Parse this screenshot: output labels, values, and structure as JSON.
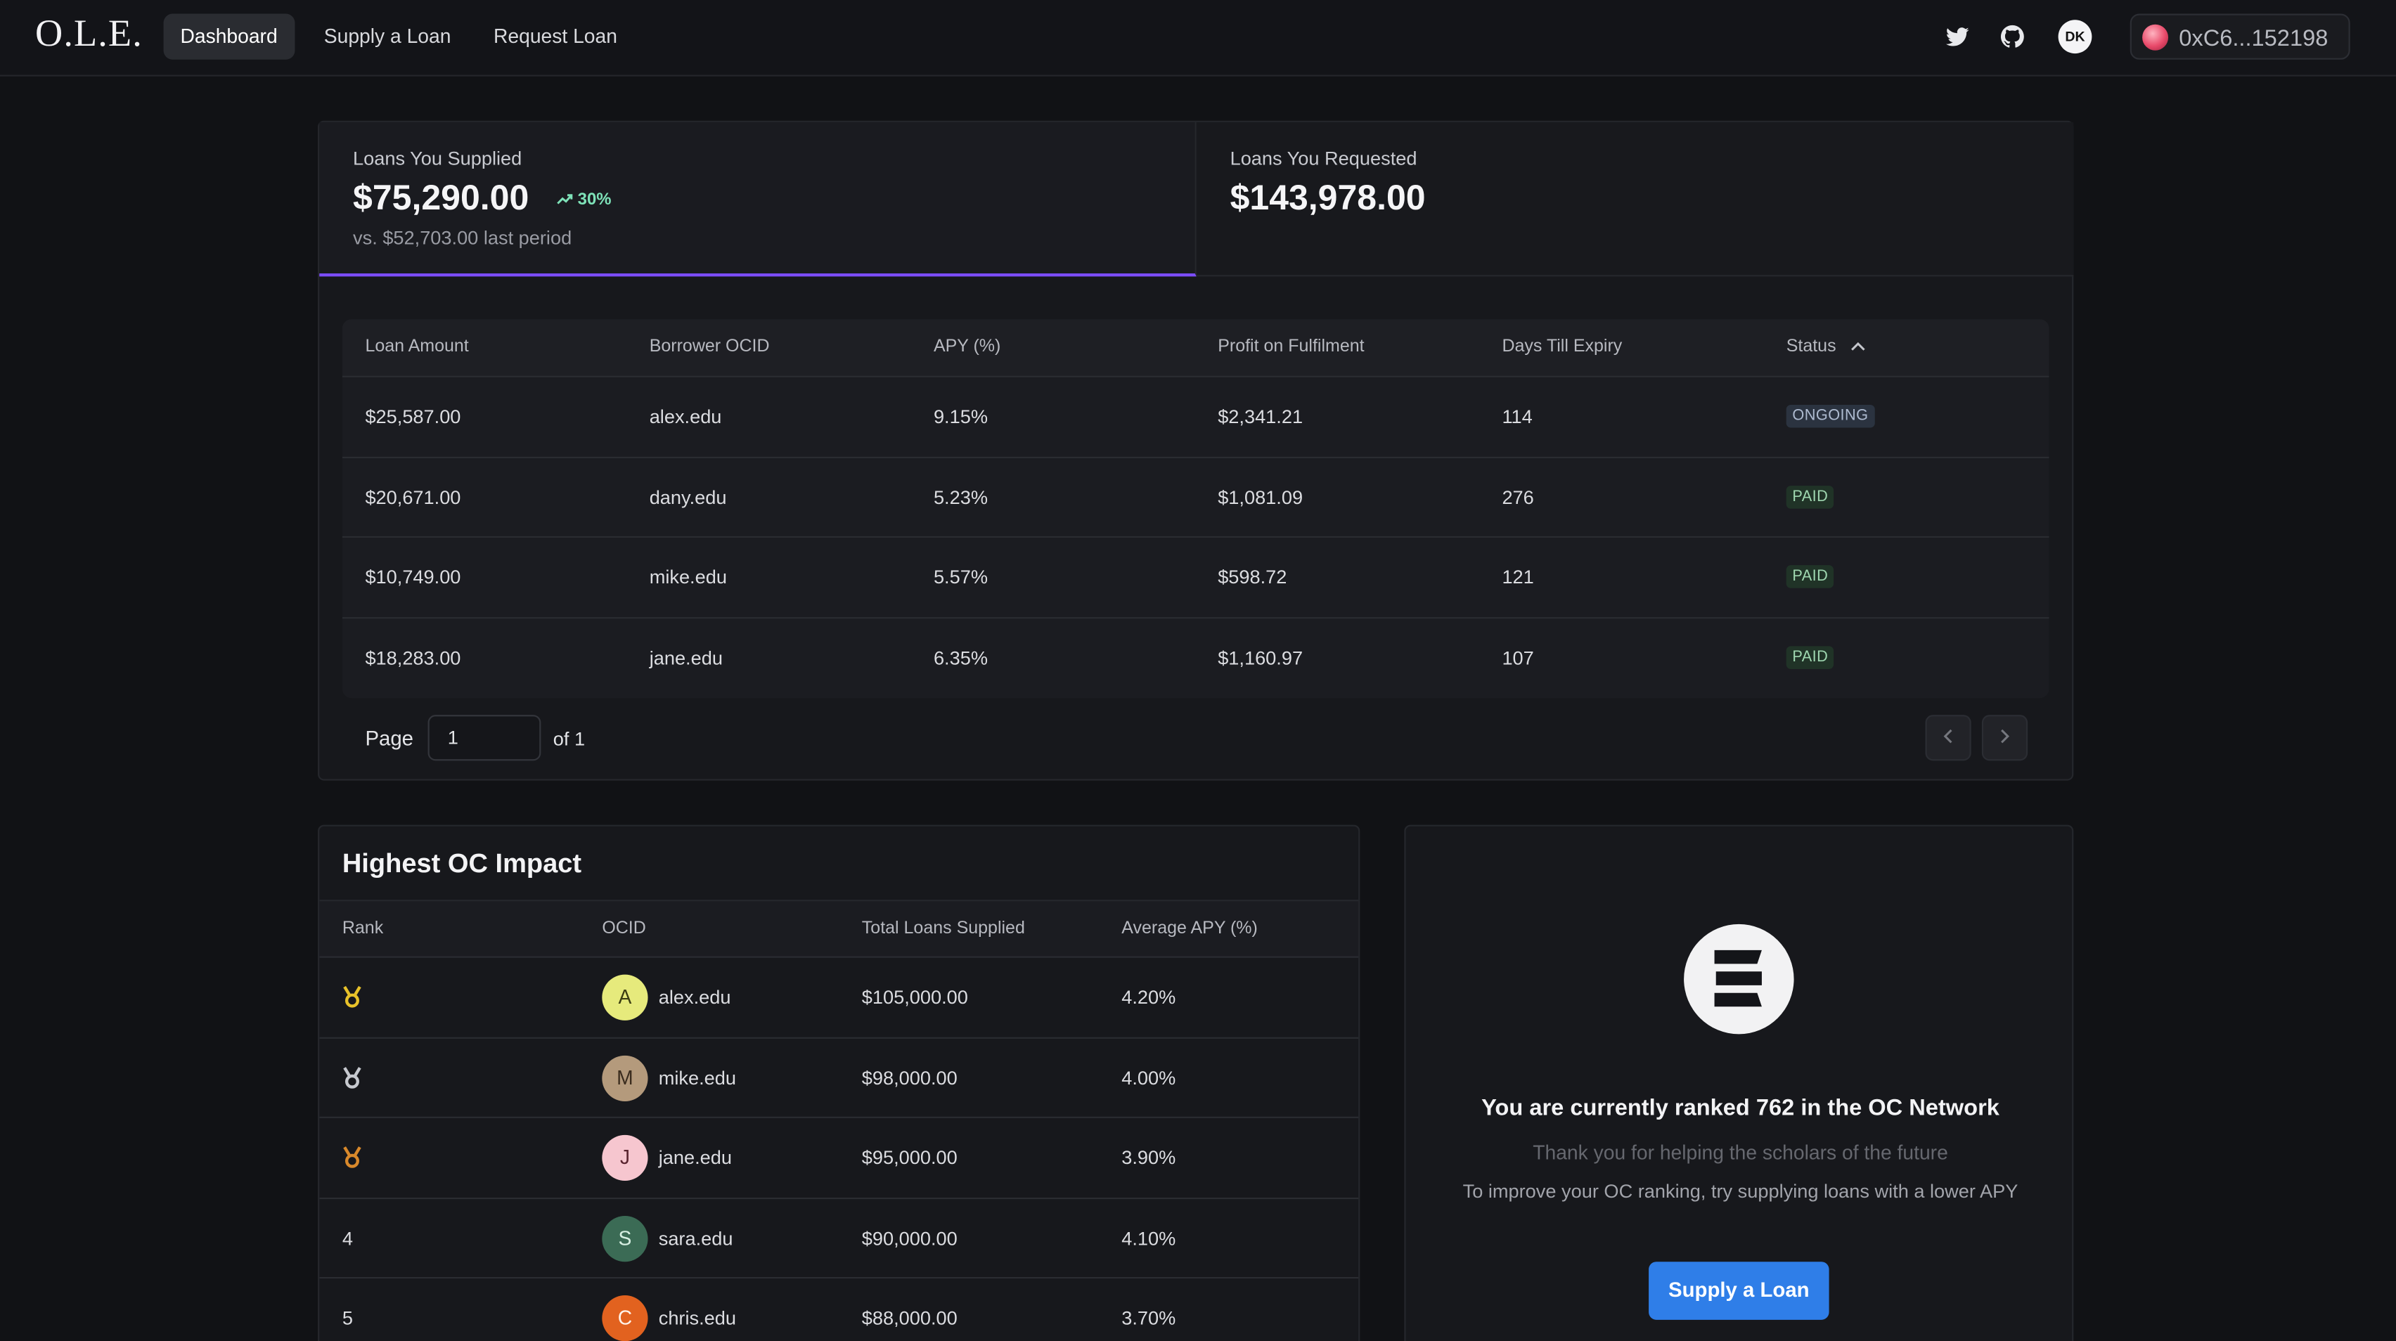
{
  "brand": {
    "logo_text": "O.L.E."
  },
  "nav": {
    "links": [
      "Dashboard",
      "Supply a Loan",
      "Request Loan"
    ],
    "active": "Dashboard",
    "user_initials": "DK",
    "wallet_address": "0xC6...152198"
  },
  "stats": {
    "supplied": {
      "label": "Loans You Supplied",
      "value": "$75,290.00",
      "delta": "30%",
      "compare": "vs. $52,703.00 last period"
    },
    "requested": {
      "label": "Loans You Requested",
      "value": "$143,978.00"
    }
  },
  "loans_table": {
    "columns": [
      "Loan Amount",
      "Borrower OCID",
      "APY (%)",
      "Profit on Fulfilment",
      "Days Till Expiry",
      "Status"
    ],
    "rows": [
      {
        "amount": "$25,587.00",
        "ocid": "alex.edu",
        "apy": "9.15%",
        "profit": "$2,341.21",
        "days": "114",
        "status": "ONGOING"
      },
      {
        "amount": "$20,671.00",
        "ocid": "dany.edu",
        "apy": "5.23%",
        "profit": "$1,081.09",
        "days": "276",
        "status": "PAID"
      },
      {
        "amount": "$10,749.00",
        "ocid": "mike.edu",
        "apy": "5.57%",
        "profit": "$598.72",
        "days": "121",
        "status": "PAID"
      },
      {
        "amount": "$18,283.00",
        "ocid": "jane.edu",
        "apy": "6.35%",
        "profit": "$1,160.97",
        "days": "107",
        "status": "PAID"
      }
    ]
  },
  "pagination": {
    "page_label": "Page",
    "current_page": "1",
    "of_label": "of 1"
  },
  "leaderboard": {
    "title": "Highest OC Impact",
    "columns": [
      "Rank",
      "OCID",
      "Total Loans Supplied",
      "Average APY (%)"
    ],
    "rows": [
      {
        "rank": "",
        "medal": "gold",
        "initial": "A",
        "avatar_color": "#e6ea7c",
        "avatar_text": "#3b3d12",
        "ocid": "alex.edu",
        "total": "$105,000.00",
        "apy": "4.20%"
      },
      {
        "rank": "",
        "medal": "silver",
        "initial": "M",
        "avatar_color": "#b49a7c",
        "avatar_text": "#3a2c1e",
        "ocid": "mike.edu",
        "total": "$98,000.00",
        "apy": "4.00%"
      },
      {
        "rank": "",
        "medal": "bronze",
        "initial": "J",
        "avatar_color": "#f6c6cf",
        "avatar_text": "#5a2530",
        "ocid": "jane.edu",
        "total": "$95,000.00",
        "apy": "3.90%"
      },
      {
        "rank": "4",
        "medal": "",
        "initial": "S",
        "avatar_color": "#3b6b55",
        "avatar_text": "#d7efe2",
        "ocid": "sara.edu",
        "total": "$90,000.00",
        "apy": "4.10%"
      },
      {
        "rank": "5",
        "medal": "",
        "initial": "C",
        "avatar_color": "#e2621f",
        "avatar_text": "#fff3ea",
        "ocid": "chris.edu",
        "total": "$88,000.00",
        "apy": "3.70%"
      }
    ]
  },
  "rank_panel": {
    "title": "You are currently ranked 762 in the OC Network",
    "thanks": "Thank you for helping the scholars of the future",
    "tip": "To improve your OC ranking, try supplying loans with a lower APY",
    "cta": "Supply a Loan"
  },
  "colors": {
    "accent": "#7c4dff",
    "cta": "#2f7ee8",
    "gold": "#e8c22a",
    "silver": "#c7c9cf",
    "bronze": "#d9892b"
  }
}
